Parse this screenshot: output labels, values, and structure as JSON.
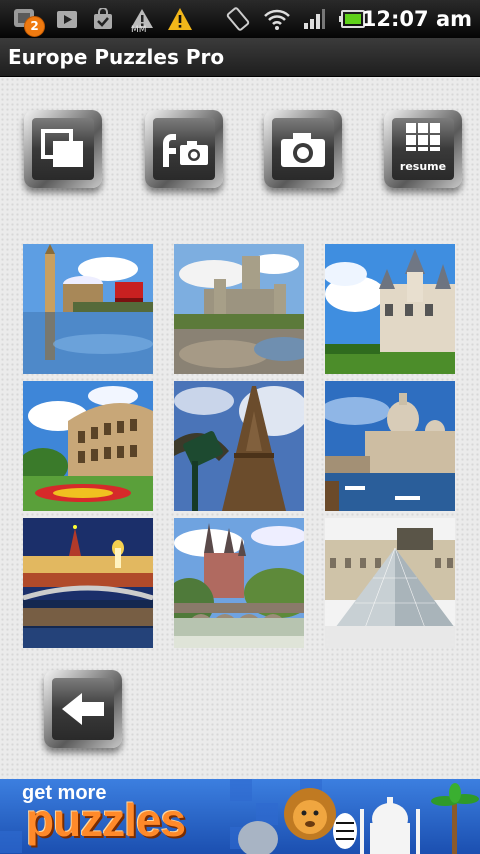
{
  "status_bar": {
    "notification_count": "2",
    "carrier_label": "MM",
    "time": "12:07 am",
    "icons": [
      "update-notification-icon",
      "play-store-icon",
      "shopping-bag-icon",
      "signal-mm-icon",
      "warning-icon",
      "screen-rotation-icon",
      "wifi-icon",
      "cell-signal-icon",
      "battery-icon"
    ]
  },
  "app": {
    "title": "Europe Puzzles Pro"
  },
  "toolbar": {
    "buttons": [
      "gallery",
      "facebook-photo",
      "camera",
      "resume"
    ],
    "resume_label": "resume"
  },
  "puzzles": [
    {
      "name": "big-ben-london"
    },
    {
      "name": "castle-wales"
    },
    {
      "name": "chateau-chambord"
    },
    {
      "name": "colosseum-rome"
    },
    {
      "name": "eiffel-tower-paris"
    },
    {
      "name": "venice-grand-canal"
    },
    {
      "name": "kremlin-moscow"
    },
    {
      "name": "limburg-cathedral"
    },
    {
      "name": "louvre-pyramid-paris"
    }
  ],
  "back_button": {
    "icon": "back-arrow-icon"
  },
  "banner": {
    "line1": "get more",
    "line2": "puzzles"
  }
}
